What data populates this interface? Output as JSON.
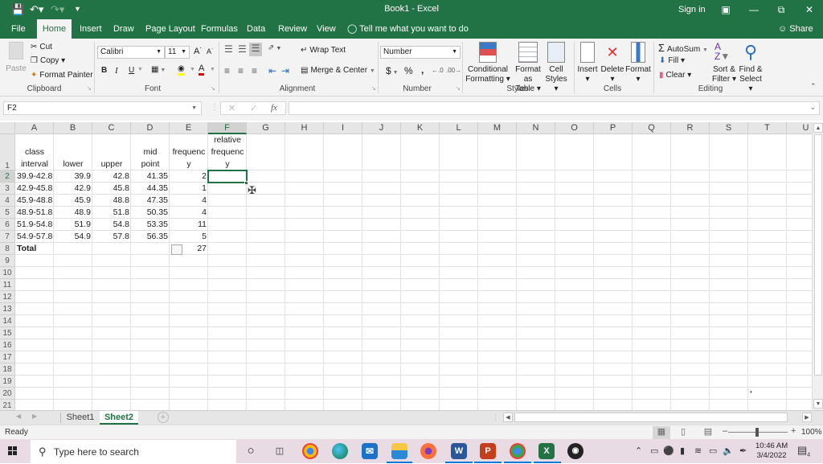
{
  "titlebar": {
    "title": "Book1 - Excel",
    "sign_in": "Sign in",
    "qat": {
      "save_icon": "save-icon",
      "undo_icon": "undo-icon",
      "redo_icon": "redo-icon",
      "customize_icon": "customize-qat-icon"
    },
    "window_buttons": [
      "ribbon-display-options",
      "minimize",
      "restore",
      "close"
    ]
  },
  "tabs": [
    {
      "label": "File"
    },
    {
      "label": "Home",
      "active": true
    },
    {
      "label": "Insert"
    },
    {
      "label": "Draw"
    },
    {
      "label": "Page Layout"
    },
    {
      "label": "Formulas"
    },
    {
      "label": "Data"
    },
    {
      "label": "Review"
    },
    {
      "label": "View"
    }
  ],
  "tell_me": "Tell me what you want to do",
  "share": "Share",
  "ribbon": {
    "clipboard": {
      "label": "Clipboard",
      "paste": "Paste",
      "cut": "Cut",
      "copy": "Copy",
      "format_painter": "Format Painter"
    },
    "font": {
      "label": "Font",
      "font_name": "Calibri",
      "font_size": "11",
      "bold": "B",
      "italic": "I",
      "underline": "U"
    },
    "alignment": {
      "label": "Alignment",
      "wrap_text": "Wrap Text",
      "merge_center": "Merge & Center"
    },
    "number": {
      "label": "Number",
      "format": "Number",
      "currency": "$",
      "percent": "%",
      "comma": ","
    },
    "styles": {
      "label": "Styles",
      "conditional_formatting": [
        "Conditional",
        "Formatting"
      ],
      "format_as_table": [
        "Format as",
        "Table"
      ],
      "cell_styles": [
        "Cell",
        "Styles"
      ]
    },
    "cells": {
      "label": "Cells",
      "insert": "Insert",
      "delete": "Delete",
      "format": "Format"
    },
    "editing": {
      "label": "Editing",
      "autosum": "AutoSum",
      "fill": "Fill",
      "clear": "Clear",
      "sort_filter": [
        "Sort &",
        "Filter"
      ],
      "find_select": [
        "Find &",
        "Select"
      ]
    }
  },
  "formula_bar": {
    "name_box": "F2",
    "formula": "",
    "cancel": "✕",
    "enter": "✓",
    "fx": "fx"
  },
  "columns": [
    "A",
    "B",
    "C",
    "D",
    "E",
    "F",
    "G",
    "H",
    "I",
    "J",
    "K",
    "L",
    "M",
    "N",
    "O",
    "P",
    "Q",
    "R",
    "S",
    "T",
    "U"
  ],
  "selected_column": "F",
  "rows": [
    "1",
    "2",
    "3",
    "4",
    "5",
    "6",
    "7",
    "8",
    "9",
    "10",
    "11",
    "12",
    "13",
    "14",
    "15",
    "16",
    "17",
    "18",
    "19",
    "20",
    "21"
  ],
  "selected_row": "2",
  "sheet": {
    "header": {
      "A": [
        "class",
        "interval"
      ],
      "B": [
        "lower"
      ],
      "C": [
        "upper"
      ],
      "D": [
        "mid",
        "point"
      ],
      "E": [
        "frequenc",
        "y"
      ],
      "F": [
        "relative",
        "frequenc",
        "y"
      ]
    },
    "data": [
      {
        "A": "39.9-42.8",
        "B": "39.9",
        "C": "42.8",
        "D": "41.35",
        "E": "2"
      },
      {
        "A": "42.9-45.8",
        "B": "42.9",
        "C": "45.8",
        "D": "44.35",
        "E": "1"
      },
      {
        "A": "45.9-48.8",
        "B": "45.9",
        "C": "48.8",
        "D": "47.35",
        "E": "4"
      },
      {
        "A": "48.9-51.8",
        "B": "48.9",
        "C": "51.8",
        "D": "50.35",
        "E": "4"
      },
      {
        "A": "51.9-54.8",
        "B": "51.9",
        "C": "54.8",
        "D": "53.35",
        "E": "11"
      },
      {
        "A": "54.9-57.8",
        "B": "54.9",
        "C": "57.8",
        "D": "56.35",
        "E": "5"
      }
    ],
    "total": {
      "A": "Total",
      "E": "27"
    },
    "active_cell": "F2"
  },
  "sheet_tabs": [
    {
      "label": "Sheet1"
    },
    {
      "label": "Sheet2",
      "active": true
    }
  ],
  "status": {
    "text": "Ready",
    "zoom": "100%",
    "zoom_value": 100
  },
  "taskbar": {
    "search_placeholder": "Type here to search",
    "apps": [
      "cortana",
      "task-view",
      "chrome",
      "edge",
      "mail",
      "file-explorer",
      "firefox",
      "word",
      "powerpoint",
      "chrome-profile",
      "excel",
      "obs"
    ],
    "time": "10:46 AM",
    "date": "3/4/2022",
    "notifications": "4"
  }
}
